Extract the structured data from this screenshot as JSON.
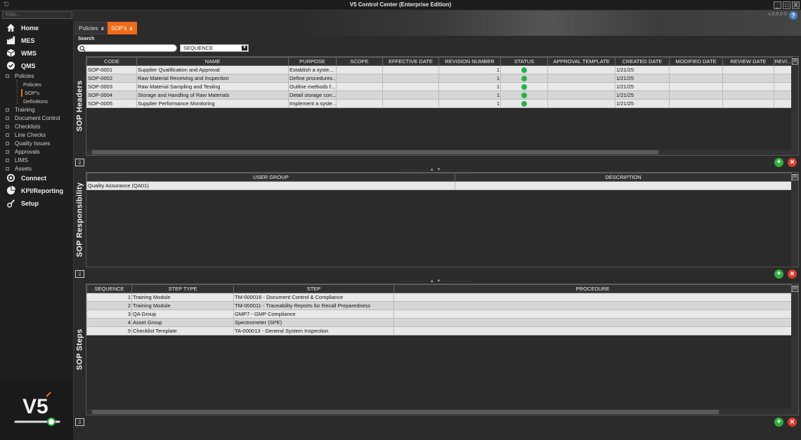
{
  "app": {
    "title": "V5 Control Center (Enterprise Edition)",
    "version": "v.5.9.0.0",
    "help": "?",
    "minimize": "_",
    "maximize": "□",
    "close": "X",
    "app_icon": "⎋",
    "logo_text": "V5"
  },
  "sidebar": {
    "filter_placeholder": "Filter...",
    "main_top": [
      {
        "label": "Home",
        "icon": "home-icon"
      },
      {
        "label": "MES",
        "icon": "factory-icon"
      },
      {
        "label": "WMS",
        "icon": "cube-icon"
      },
      {
        "label": "QMS",
        "icon": "check-circle-icon"
      }
    ],
    "policies_group": "Policies",
    "policies_children": [
      "Policies",
      "SOP's",
      "Definitions"
    ],
    "sub_items": [
      "Training",
      "Document Control",
      "Checklists",
      "Line Checks",
      "Quality Issues",
      "Approvals",
      "LIMS",
      "Assets"
    ],
    "main_bottom": [
      {
        "label": "Connect",
        "icon": "connect-icon"
      },
      {
        "label": "KPI/Reporting",
        "icon": "pie-chart-icon"
      },
      {
        "label": "Setup",
        "icon": "setup-icon"
      }
    ]
  },
  "tabs": [
    {
      "label": "Policies",
      "close": "x"
    },
    {
      "label": "SOP's",
      "close": "x"
    }
  ],
  "search": {
    "label": "Search",
    "value": "",
    "dropdown_value": "SEQUENCE"
  },
  "sop_headers": {
    "section_label": "SOP Headers",
    "columns": [
      "CODE",
      "NAME",
      "PURPOSE",
      "SCOPE",
      "EFFECTIVE DATE",
      "REVISION NUMBER",
      "STATUS",
      "APPROVAL TEMPLATE",
      "CREATED DATE",
      "MODIFIED DATE",
      "REVIEW DATE",
      "REVI..."
    ],
    "rows": [
      {
        "code": "SOP-0001",
        "name": "Supplier Qualification and Approval",
        "purpose": "Establish a syste...",
        "scope": "",
        "effective_date": "",
        "revision": "1",
        "status": "active",
        "approval_template": "",
        "created": "1/21/25",
        "modified": "",
        "review": ""
      },
      {
        "code": "SOP-0002",
        "name": "Raw Material Receiving and Inspection",
        "purpose": "Define procedures...",
        "scope": "",
        "effective_date": "",
        "revision": "1",
        "status": "active",
        "approval_template": "",
        "created": "1/21/25",
        "modified": "",
        "review": ""
      },
      {
        "code": "SOP-0003",
        "name": "Raw Material Sampling and Testing",
        "purpose": "Outline methods f...",
        "scope": "",
        "effective_date": "",
        "revision": "1",
        "status": "active",
        "approval_template": "",
        "created": "1/21/25",
        "modified": "",
        "review": ""
      },
      {
        "code": "SOP-0004",
        "name": "Storage and Handling of Raw Materials",
        "purpose": "Detail storage con...",
        "scope": "",
        "effective_date": "",
        "revision": "1",
        "status": "active",
        "approval_template": "",
        "created": "1/21/25",
        "modified": "",
        "review": ""
      },
      {
        "code": "SOP-0005",
        "name": "Supplier Performance Monitoring",
        "purpose": "Implement a syste...",
        "scope": "",
        "effective_date": "",
        "revision": "1",
        "status": "active",
        "approval_template": "",
        "created": "1/21/25",
        "modified": "",
        "review": ""
      }
    ]
  },
  "sop_responsibility": {
    "section_label": "SOP Responsibility",
    "columns": [
      "USER GROUP",
      "DESCRIPTION"
    ],
    "rows": [
      {
        "user_group": "Quality Assurance (QA01)",
        "description": ""
      }
    ]
  },
  "sop_steps": {
    "section_label": "SOP Steps",
    "columns": [
      "SEQUENCE",
      "STEP TYPE",
      "STEP",
      "PROCEDURE"
    ],
    "rows": [
      {
        "sequence": "1",
        "step_type": "Training Module",
        "step": "TM-000016 - Document Control & Compliance",
        "procedure": ""
      },
      {
        "sequence": "2",
        "step_type": "Training Module",
        "step": "TM-000011 - Traceability Reports for Recall Preparedness",
        "procedure": ""
      },
      {
        "sequence": "3",
        "step_type": "QA Group",
        "step": "GMP7 - GMP Compliance",
        "procedure": ""
      },
      {
        "sequence": "4",
        "step_type": "Asset Group",
        "step": "Spectrometer (SPE)",
        "procedure": ""
      },
      {
        "sequence": "5",
        "step_type": "Checklist Template",
        "step": "TA-000013 - General System Inspection",
        "procedure": ""
      }
    ]
  },
  "actions": {
    "add": "+",
    "delete": "✕",
    "export": "⇩",
    "col_menu": "▤",
    "splitter": "· · · · · · ·  ▲  ▼  · · · · · · ·"
  },
  "colors": {
    "accent": "#f06a1a",
    "status_active": "#25b24a",
    "add": "#2fae3c",
    "delete": "#d93a2b"
  }
}
